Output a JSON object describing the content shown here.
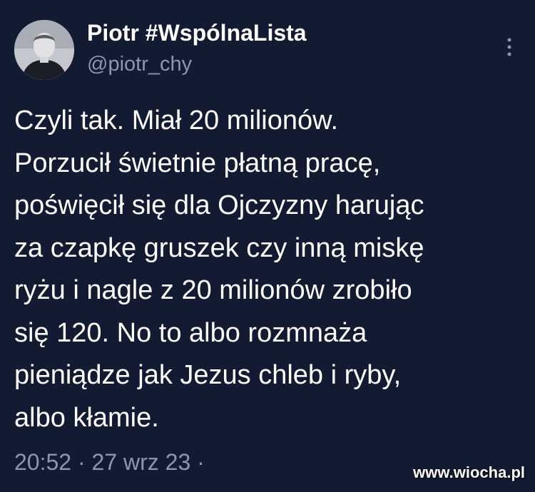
{
  "tweet": {
    "display_name": "Piotr #WspólnaLista",
    "handle": "@piotr_chy",
    "text": "Czyli tak. Miał 20 milionów.\nPorzucił świetnie płatną pracę,\npoświęcił się dla Ojczyzny harując\nza czapkę gruszek czy inną miskę\nryżu i nagle z 20 milionów zrobiło\nsię 120. No to albo rozmnaża\npieniądze jak Jezus chleb i ryby,\nalbo kłamie.",
    "time": "20:52",
    "separator": "·",
    "date": "27 wrz 23",
    "trailing_separator": "·"
  },
  "icons": {
    "avatar": "profile-photo",
    "more": "vertical-ellipsis-icon"
  },
  "watermark": "www.wiocha.pl",
  "colors": {
    "background": "#131b33",
    "primary_text": "#ffffff",
    "secondary_text": "#8b98a8"
  }
}
